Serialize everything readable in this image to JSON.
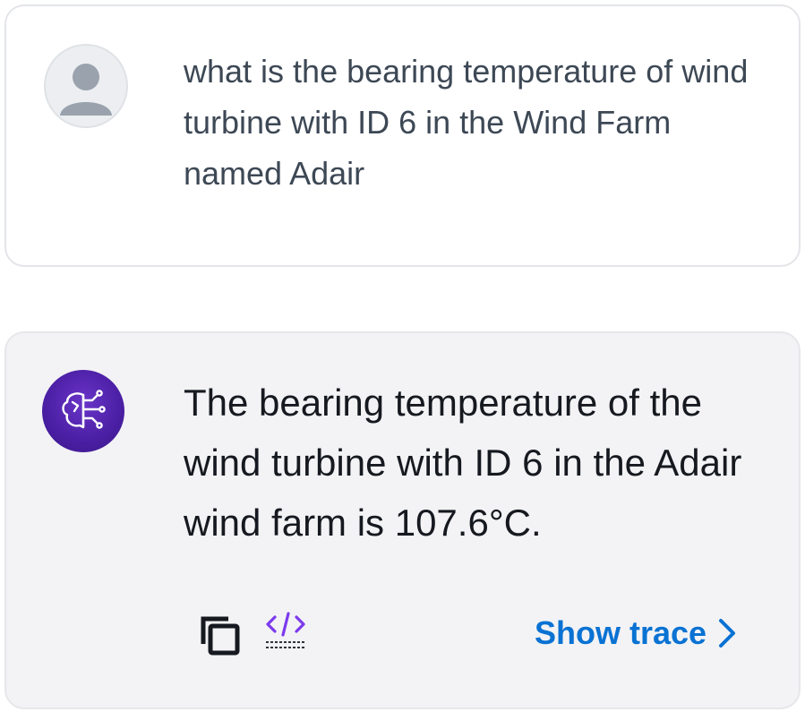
{
  "conversation": {
    "user_message": {
      "avatar_icon": "user-avatar-icon",
      "text": "what is the bearing temperature of wind turbine with ID 6 in the Wind Farm named Adair"
    },
    "assistant_message": {
      "avatar_icon": "ai-brain-circuit-icon",
      "text": "The bearing temperature of the wind turbine with ID 6 in the Adair wind farm is 107.6°C.",
      "actions": {
        "copy_icon": "copy-icon",
        "code_icon": "code-icon",
        "show_trace_label": "Show trace",
        "show_trace_icon": "chevron-right-icon"
      }
    }
  },
  "colors": {
    "accent": "#0972d3",
    "bot_avatar": "#4a1fa3",
    "code_icon": "#7c3aed",
    "assistant_bg": "#f3f3f5"
  }
}
